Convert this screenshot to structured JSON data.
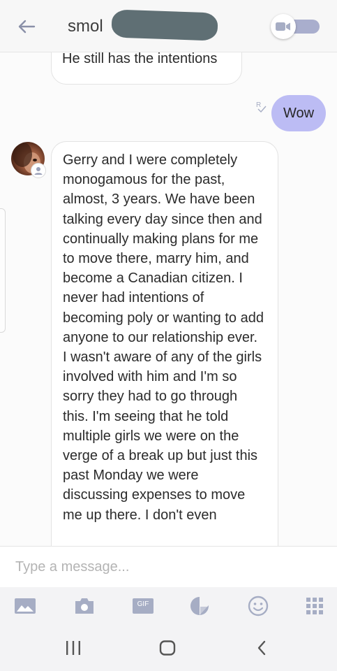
{
  "header": {
    "title": "smol",
    "back_icon": "back-arrow-icon",
    "video_icon": "video-camera-icon",
    "toggle_color": "#a9aecd"
  },
  "messages": [
    {
      "direction": "incoming",
      "text": "He still has the intentions"
    },
    {
      "direction": "outgoing",
      "text": "Wow",
      "receipt": "R",
      "bubble_color": "#bcbcf4"
    },
    {
      "direction": "incoming",
      "text": "Gerry and I were completely monogamous for the past, almost, 3 years. We have been talking every day since then and continually making plans for me to move there, marry him, and become a Canadian citizen. I never had intentions of becoming poly or wanting to add anyone to our relationship ever. I wasn't aware of any of the girls involved with him and I'm so sorry they had to go through this. I'm seeing that he told multiple girls we were on the verge of a break up but just this past Monday we were discussing expenses to move me up there. I don't even"
    }
  ],
  "composer": {
    "placeholder": "Type a message..."
  },
  "toolbar": {
    "gif_label": "GIF",
    "icons": [
      "gallery-icon",
      "camera-icon",
      "gif-icon",
      "sticker-icon",
      "emoji-icon",
      "more-apps-icon"
    ],
    "icon_color": "#a6adc4"
  },
  "navbar": {
    "icons": [
      "recent-apps-icon",
      "home-icon",
      "back-icon"
    ]
  }
}
